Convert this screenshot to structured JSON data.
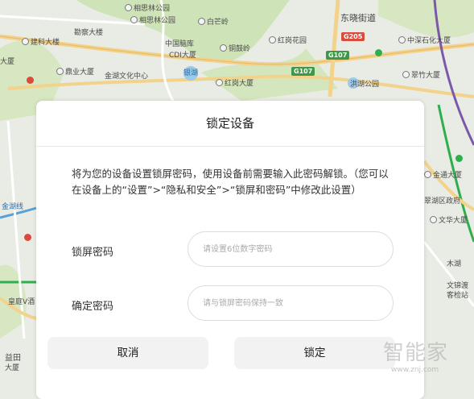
{
  "map": {
    "pois": [
      "相思林公园",
      "白芒岭",
      "建科大楼",
      "勘察大楼",
      "中国脑库",
      "CDI大厦",
      "银湖",
      "铜鼓岭",
      "东晓街道",
      "红岗花园",
      "中深石化大厦",
      "大厦",
      "鼎业大厦",
      "金湖文化中心",
      "红岗大厦",
      "洪湖公园",
      "翠竹大厦",
      "金通大厦",
      "翠湖区政府",
      "文华大厦",
      "木湖",
      "文锦渡",
      "客检站",
      "皇庭V酒",
      "益田",
      "大厦"
    ],
    "road_shields": [
      "G205",
      "G107",
      "G107"
    ],
    "road_label": "金湖线"
  },
  "dialog": {
    "title": "锁定设备",
    "description": "将为您的设备设置锁屏密码，使用设备前需要输入此密码解锁。（您可以在设备上的“设置”>“隐私和安全”>“锁屏和密码”中修改此设置）",
    "lock_password_label": "锁屏密码",
    "lock_password_placeholder": "请设置6位数字密码",
    "confirm_password_label": "确定密码",
    "confirm_password_placeholder": "请与锁屏密码保持一致",
    "cancel_label": "取消",
    "lock_label": "锁定"
  },
  "watermark": {
    "text": "智能家",
    "url": "www.znj.com"
  },
  "colors": {
    "map_background": "#e9ece4",
    "green_area": "#cfe3b8",
    "road_yellow": "#f3d28b",
    "metro_green": "#2fae4e",
    "metro_purple": "#7a5aa8",
    "button_bg": "#f2f2f2"
  }
}
